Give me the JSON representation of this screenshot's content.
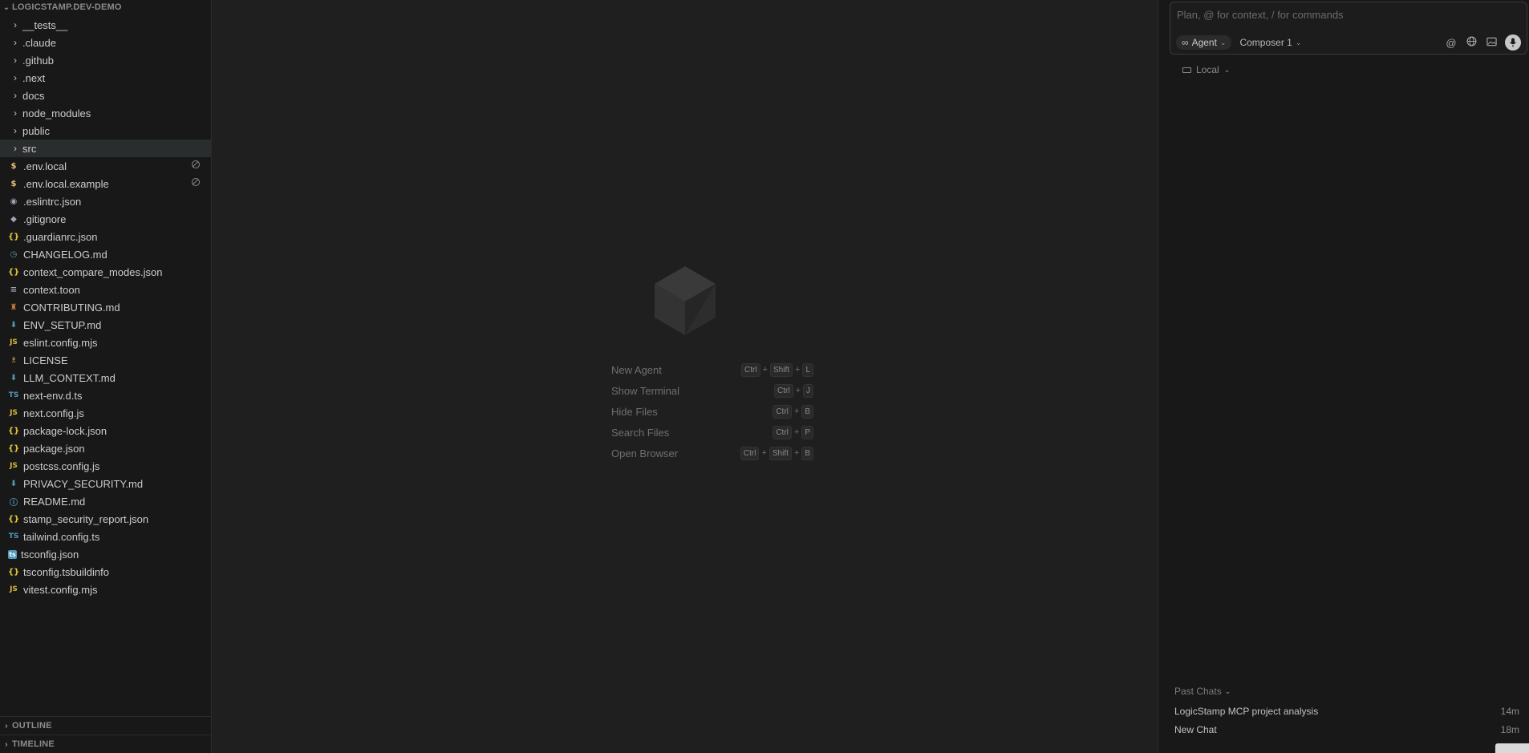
{
  "explorer": {
    "title": "LOGICSTAMP.DEV-DEMO",
    "folders": [
      {
        "label": "__tests__"
      },
      {
        "label": ".claude"
      },
      {
        "label": ".github"
      },
      {
        "label": ".next"
      },
      {
        "label": "docs"
      },
      {
        "label": "node_modules"
      },
      {
        "label": "public"
      },
      {
        "label": "src",
        "selected": true
      }
    ],
    "files": [
      {
        "label": ".env.local",
        "icon": "dollar-icon",
        "ignored": true
      },
      {
        "label": ".env.local.example",
        "icon": "dollar-icon",
        "ignored": true
      },
      {
        "label": ".eslintrc.json",
        "icon": "eslint-icon"
      },
      {
        "label": ".gitignore",
        "icon": "git-icon"
      },
      {
        "label": ".guardianrc.json",
        "icon": "json-braces-icon"
      },
      {
        "label": "CHANGELOG.md",
        "icon": "clock-icon"
      },
      {
        "label": "context_compare_modes.json",
        "icon": "json-braces-icon"
      },
      {
        "label": "context.toon",
        "icon": "lines-icon"
      },
      {
        "label": "CONTRIBUTING.md",
        "icon": "contributing-icon"
      },
      {
        "label": "ENV_SETUP.md",
        "icon": "markdown-arrow-icon"
      },
      {
        "label": "eslint.config.mjs",
        "icon": "js-icon"
      },
      {
        "label": "LICENSE",
        "icon": "license-icon"
      },
      {
        "label": "LLM_CONTEXT.md",
        "icon": "markdown-arrow-icon"
      },
      {
        "label": "next-env.d.ts",
        "icon": "ts-icon"
      },
      {
        "label": "next.config.js",
        "icon": "js-icon"
      },
      {
        "label": "package-lock.json",
        "icon": "json-braces-icon"
      },
      {
        "label": "package.json",
        "icon": "json-braces-icon"
      },
      {
        "label": "postcss.config.js",
        "icon": "js-icon"
      },
      {
        "label": "PRIVACY_SECURITY.md",
        "icon": "markdown-arrow-icon"
      },
      {
        "label": "README.md",
        "icon": "info-icon"
      },
      {
        "label": "stamp_security_report.json",
        "icon": "json-braces-icon"
      },
      {
        "label": "tailwind.config.ts",
        "icon": "ts-icon"
      },
      {
        "label": "tsconfig.json",
        "icon": "tsconfig-icon"
      },
      {
        "label": "tsconfig.tsbuildinfo",
        "icon": "json-braces-icon"
      },
      {
        "label": "vitest.config.mjs",
        "icon": "js-icon"
      }
    ],
    "outline_label": "OUTLINE",
    "timeline_label": "TIMELINE"
  },
  "shortcuts": [
    {
      "label": "New Agent",
      "keys": [
        "Ctrl",
        "Shift",
        "L"
      ]
    },
    {
      "label": "Show Terminal",
      "keys": [
        "Ctrl",
        "J"
      ]
    },
    {
      "label": "Hide Files",
      "keys": [
        "Ctrl",
        "B"
      ]
    },
    {
      "label": "Search Files",
      "keys": [
        "Ctrl",
        "P"
      ]
    },
    {
      "label": "Open Browser",
      "keys": [
        "Ctrl",
        "Shift",
        "B"
      ]
    }
  ],
  "composer": {
    "placeholder": "Plan, @ for context, / for commands",
    "mode_label": "Agent",
    "model_label": "Composer 1",
    "location_label": "Local"
  },
  "past_chats": {
    "title": "Past Chats",
    "items": [
      {
        "title": "LogicStamp MCP project analysis",
        "time": "14m"
      },
      {
        "title": "New Chat",
        "time": "18m"
      }
    ]
  },
  "colors": {
    "background": "#181818",
    "editor": "#1f1f1f",
    "selected_row": "#2a2d2e"
  }
}
